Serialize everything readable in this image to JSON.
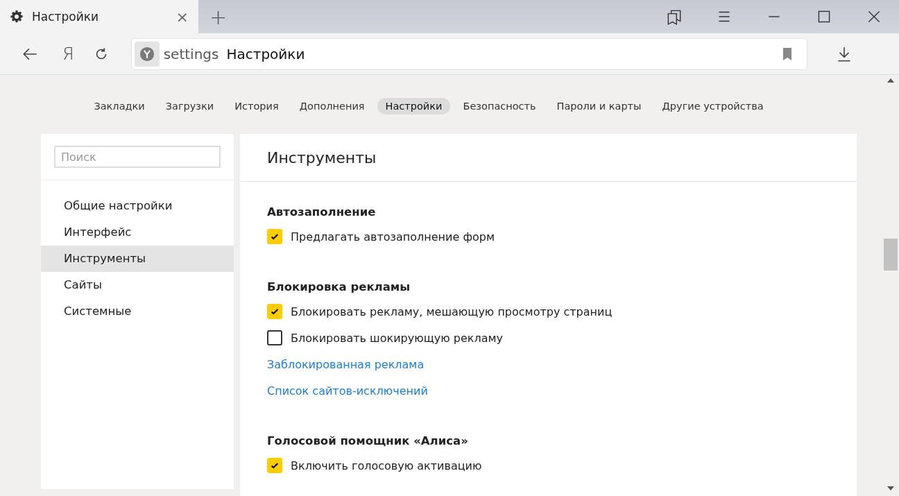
{
  "tab": {
    "title": "Настройки",
    "close": "×"
  },
  "new_tab": "+",
  "toolbar": {
    "logo": "Я",
    "address": {
      "host": "settings",
      "title": "Настройки"
    }
  },
  "nav": [
    {
      "label": "Закладки",
      "selected": false
    },
    {
      "label": "Загрузки",
      "selected": false
    },
    {
      "label": "История",
      "selected": false
    },
    {
      "label": "Дополнения",
      "selected": false
    },
    {
      "label": "Настройки",
      "selected": true
    },
    {
      "label": "Безопасность",
      "selected": false
    },
    {
      "label": "Пароли и карты",
      "selected": false
    },
    {
      "label": "Другие устройства",
      "selected": false
    }
  ],
  "sidebar": {
    "search": {
      "placeholder": "Поиск"
    },
    "items": [
      {
        "label": "Общие настройки",
        "selected": false
      },
      {
        "label": "Интерфейс",
        "selected": false
      },
      {
        "label": "Инструменты",
        "selected": true
      },
      {
        "label": "Сайты",
        "selected": false
      },
      {
        "label": "Системные",
        "selected": false
      }
    ]
  },
  "main": {
    "title": "Инструменты",
    "sections": [
      {
        "heading": "Автозаполнение",
        "items": [
          {
            "kind": "checkbox",
            "label": "Предлагать автозаполнение форм",
            "checked": true
          }
        ]
      },
      {
        "heading": "Блокировка рекламы",
        "items": [
          {
            "kind": "checkbox",
            "label": "Блокировать рекламу, мешающую просмотру страниц",
            "checked": true
          },
          {
            "kind": "checkbox",
            "label": "Блокировать шокирующую рекламу",
            "checked": false
          },
          {
            "kind": "link",
            "label": "Заблокированная реклама"
          },
          {
            "kind": "link",
            "label": "Список сайтов-исключений"
          }
        ]
      },
      {
        "heading": "Голосовой помощник «Алиса»",
        "items": [
          {
            "kind": "checkbox",
            "label": "Включить голосовую активацию",
            "checked": true
          }
        ]
      }
    ]
  }
}
